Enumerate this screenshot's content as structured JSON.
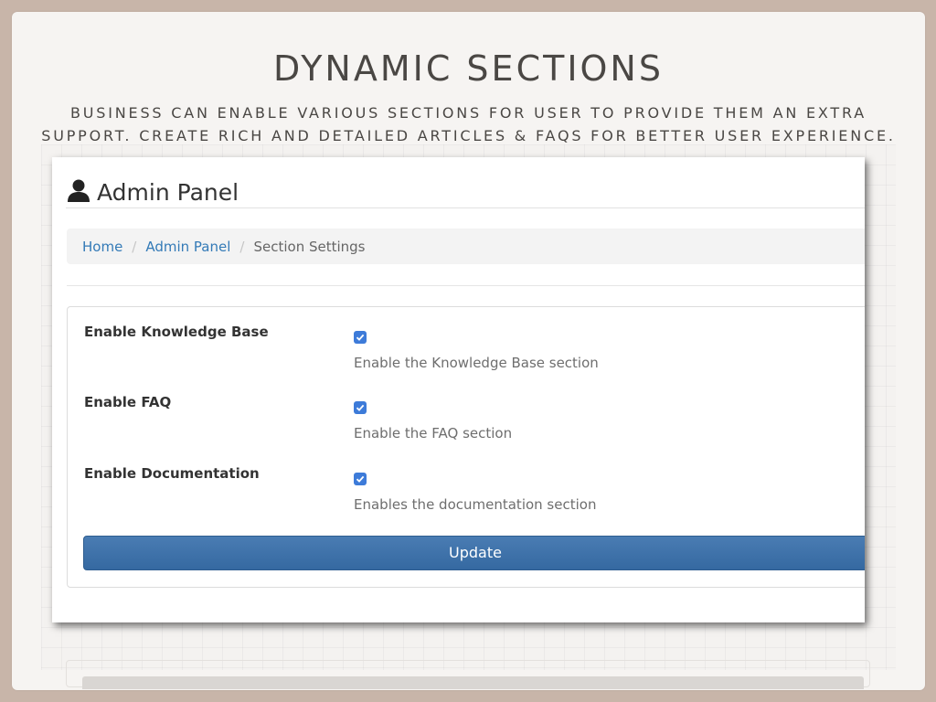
{
  "slide": {
    "title": "DYNAMIC SECTIONS",
    "subtitle_line1": "Business can enable various sections for user to provide them an extra",
    "subtitle_line2": "support. Create rich and detailed articles & FAQs for better user experience."
  },
  "app": {
    "title": "Admin Panel",
    "title_icon": "user-icon"
  },
  "breadcrumb": {
    "items": [
      {
        "label": "Home",
        "link": true
      },
      {
        "label": "Admin Panel",
        "link": true
      },
      {
        "label": "Section Settings",
        "link": false
      }
    ],
    "separator": "/"
  },
  "settings": [
    {
      "label": "Enable Knowledge Base",
      "checked": true,
      "help": "Enable the Knowledge Base section"
    },
    {
      "label": "Enable FAQ",
      "checked": true,
      "help": "Enable the FAQ section"
    },
    {
      "label": "Enable Documentation",
      "checked": true,
      "help": "Enables the documentation section"
    }
  ],
  "actions": {
    "update_label": "Update"
  },
  "colors": {
    "accent": "#3d7bd9",
    "button": "#3b6ea5",
    "link": "#337ab7",
    "backdrop": "#c8b5a9"
  }
}
